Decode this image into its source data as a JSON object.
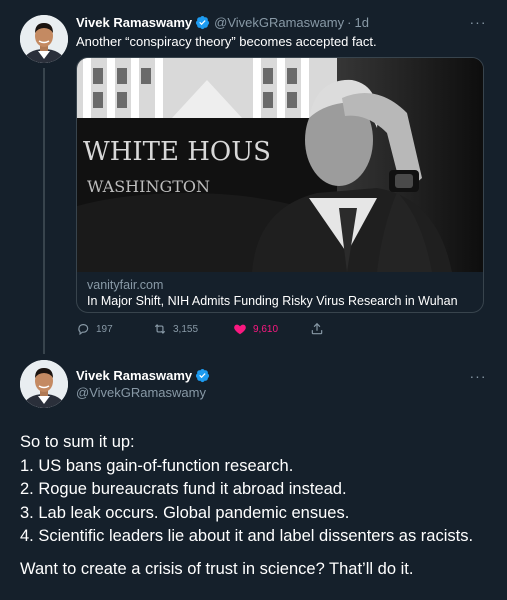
{
  "tweet1": {
    "author_name": "Vivek Ramaswamy",
    "handle": "@VivekGRamaswamy",
    "separator": "·",
    "time": "1d",
    "text": "Another “conspiracy theory” becomes accepted fact.",
    "card": {
      "image_sign_line1": "WHITE HOUS",
      "image_sign_line2": "WASHINGTON",
      "domain": "vanityfair.com",
      "title": "In Major Shift, NIH Admits Funding Risky Virus Research in Wuhan"
    },
    "actions": {
      "replies": "197",
      "retweets": "3,155",
      "likes": "9,610"
    }
  },
  "tweet2": {
    "author_name": "Vivek Ramaswamy",
    "handle": "@VivekGRamaswamy",
    "lines": [
      "So to sum it up:",
      "1. US bans gain-of-function research.",
      "2. Rogue bureaucrats fund it abroad instead.",
      "3. Lab leak occurs. Global pandemic ensues.",
      "4. Scientific leaders lie about it and label dissenters as racists."
    ],
    "closing": "Want to create a crisis of trust in science? That’ll do it."
  },
  "colors": {
    "background": "#15202b",
    "secondary_text": "#8899a6",
    "border": "#38444d",
    "like": "#f91880",
    "verified": "#1d9bf0"
  },
  "icons": [
    "more-icon",
    "verified-icon",
    "reply-icon",
    "retweet-icon",
    "like-icon",
    "share-icon"
  ]
}
